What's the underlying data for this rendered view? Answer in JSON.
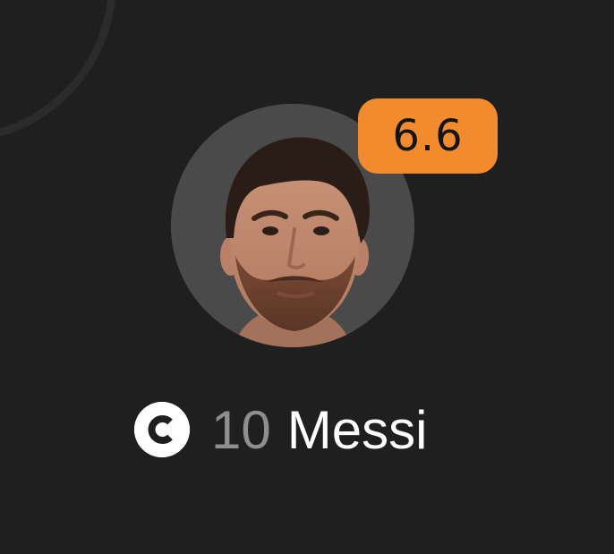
{
  "player": {
    "rating": "6.6",
    "shirt_number": "10",
    "name": "Messi",
    "is_captain": true,
    "captain_icon": "captain-c-icon",
    "avatar": "player-photo"
  },
  "colors": {
    "background": "#1f1f1f",
    "rating_badge": "#f28a2e",
    "avatar_background": "#4a4a4a",
    "name_text": "#ffffff",
    "number_text": "#8e8e8e"
  }
}
